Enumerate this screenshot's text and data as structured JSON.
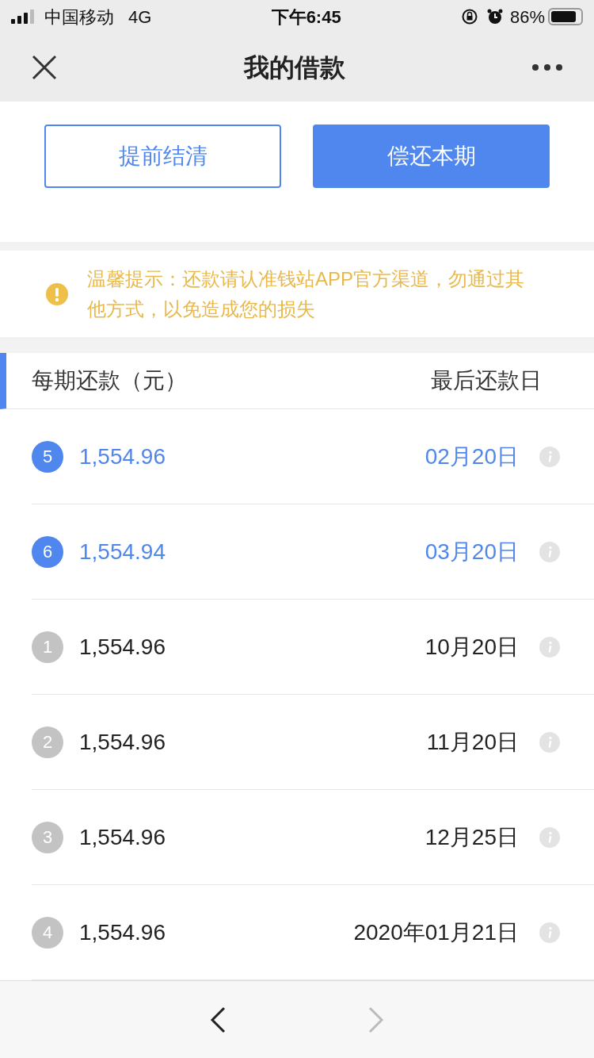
{
  "status_bar": {
    "carrier": "中国移动",
    "network": "4G",
    "time": "下午6:45",
    "battery": "86%"
  },
  "nav": {
    "title": "我的借款"
  },
  "actions": [
    {
      "label": "提前结清",
      "kind": "outline"
    },
    {
      "label": "偿还本期",
      "kind": "primary"
    }
  ],
  "notice": {
    "text": "温馨提示：还款请认准钱站APP官方渠道，勿通过其他方式，以免造成您的损失"
  },
  "table": {
    "columns": [
      "每期还款（元）",
      "最后还款日"
    ],
    "rows": [
      {
        "index": "5",
        "amount": "1,554.96",
        "due": "02月20日",
        "current": true
      },
      {
        "index": "6",
        "amount": "1,554.94",
        "due": "03月20日",
        "current": true
      },
      {
        "index": "1",
        "amount": "1,554.96",
        "due": "10月20日",
        "current": false
      },
      {
        "index": "2",
        "amount": "1,554.96",
        "due": "11月20日",
        "current": false
      },
      {
        "index": "3",
        "amount": "1,554.96",
        "due": "12月25日",
        "current": false
      },
      {
        "index": "4",
        "amount": "1,554.96",
        "due": "2020年01月21日",
        "current": false
      }
    ]
  },
  "bottom_bar": {
    "back_disabled": false,
    "forward_disabled": true
  }
}
